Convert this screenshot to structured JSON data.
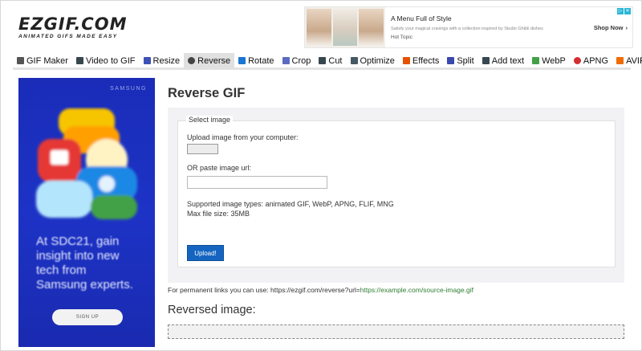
{
  "header": {
    "logo_main": "EZGIF.COM",
    "logo_tagline": "ANIMATED GIFS MADE EASY"
  },
  "top_ad": {
    "title": "A Menu Full of Style",
    "description": "Satisfy your magical cravings with a collection inspired by Studio Ghibli dishes",
    "brand": "Hot Topic",
    "cta": "Shop Now",
    "cta_arrow": "›"
  },
  "nav": {
    "items": [
      {
        "label": "GIF Maker",
        "icon": "gif-maker-icon",
        "color": "#555555"
      },
      {
        "label": "Video to GIF",
        "icon": "video-icon",
        "color": "#37474f"
      },
      {
        "label": "Resize",
        "icon": "resize-icon",
        "color": "#3f51b5"
      },
      {
        "label": "Reverse",
        "icon": "reverse-icon",
        "color": "#444444",
        "active": true
      },
      {
        "label": "Rotate",
        "icon": "rotate-icon",
        "color": "#1976d2"
      },
      {
        "label": "Crop",
        "icon": "crop-icon",
        "color": "#5c6bc0"
      },
      {
        "label": "Cut",
        "icon": "cut-icon",
        "color": "#37474f"
      },
      {
        "label": "Optimize",
        "icon": "optimize-icon",
        "color": "#455a64"
      },
      {
        "label": "Effects",
        "icon": "effects-icon",
        "color": "#e65100"
      },
      {
        "label": "Split",
        "icon": "split-icon",
        "color": "#3949ab"
      },
      {
        "label": "Add text",
        "icon": "add-text-icon",
        "color": "#37474f"
      },
      {
        "label": "WebP",
        "icon": "webp-icon",
        "color": "#43a047"
      },
      {
        "label": "APNG",
        "icon": "apng-icon",
        "color": "#d32f2f"
      },
      {
        "label": "AVIF",
        "icon": "avif-icon",
        "color": "#ef6c00"
      }
    ]
  },
  "left_ad": {
    "brand": "SAMSUNG",
    "copy": "At SDC21, gain insight into new tech from Samsung experts.",
    "cta": "SIGN UP"
  },
  "main": {
    "page_title": "Reverse GIF",
    "fieldset_legend": "Select image",
    "upload_label": "Upload image from your computer:",
    "url_label": "OR paste image url:",
    "url_placeholder": "",
    "supported_types": "Supported image types: animated GIF, WebP, APNG, FLIF, MNG",
    "max_size": "Max file size: 35MB",
    "upload_button": "Upload!",
    "permanent_prefix": "For permanent links you can use: https://ezgif.com/reverse?url=",
    "permanent_link": "https://example.com/source-image.gif",
    "output_title": "Reversed image:"
  }
}
